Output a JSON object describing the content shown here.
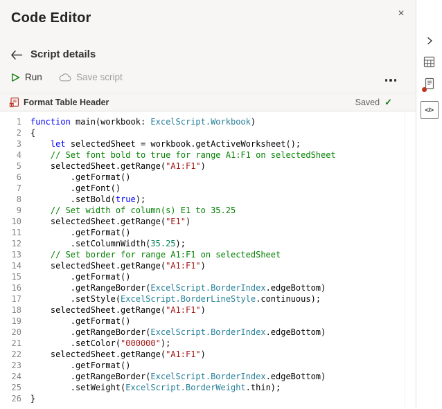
{
  "panel": {
    "title": "Code Editor"
  },
  "nav": {
    "back_label": "Script details"
  },
  "toolbar": {
    "run": "Run",
    "save": "Save script"
  },
  "script_header": {
    "name": "Format Table Header",
    "status": "Saved"
  },
  "rail": {
    "code_glyph": "</>"
  },
  "icons": {
    "close": "✕",
    "saved_check": "✓",
    "back_arrow": "left-arrow",
    "run_play": "play-triangle-outline",
    "save_cloud": "cloud",
    "more_ellipsis": "three-dots",
    "collapse_chevron": "chevron-right",
    "rail_table": "table-grid",
    "rail_scripts": "document-with-red-badge",
    "rail_code": "code-brackets"
  },
  "colors": {
    "run_green": "#107C10",
    "saved_check_green": "#107C10",
    "script_icon_red": "#B83426",
    "badge_red": "#C03522",
    "header_bg": "#f7f6f5"
  },
  "code": {
    "token_colors": {
      "kw": "#0000FF",
      "ty": "#267F99",
      "str": "#A31515",
      "com": "#008000",
      "num": "#098658",
      "pl": "#000000"
    },
    "lines": [
      [
        [
          "function",
          "kw"
        ],
        [
          " main(workbook: ",
          "pl"
        ],
        [
          "ExcelScript.Workbook",
          "ty"
        ],
        [
          ")",
          "pl"
        ]
      ],
      [
        [
          "{",
          "pl"
        ]
      ],
      [
        [
          "    ",
          "pl"
        ],
        [
          "let",
          "kw"
        ],
        [
          " selectedSheet = workbook.getActiveWorksheet();",
          "pl"
        ]
      ],
      [
        [
          "    // Set font bold to true for range A1:F1 on selectedSheet",
          "com"
        ]
      ],
      [
        [
          "    selectedSheet.getRange(",
          "pl"
        ],
        [
          "\"A1:F1\"",
          "str"
        ],
        [
          ")",
          "pl"
        ]
      ],
      [
        [
          "        .getFormat()",
          "pl"
        ]
      ],
      [
        [
          "        .getFont()",
          "pl"
        ]
      ],
      [
        [
          "        .setBold(",
          "pl"
        ],
        [
          "true",
          "kw"
        ],
        [
          ");",
          "pl"
        ]
      ],
      [
        [
          "    // Set width of column(s) E1 to 35.25",
          "com"
        ]
      ],
      [
        [
          "    selectedSheet.getRange(",
          "pl"
        ],
        [
          "\"E1\"",
          "str"
        ],
        [
          ")",
          "pl"
        ]
      ],
      [
        [
          "        .getFormat()",
          "pl"
        ]
      ],
      [
        [
          "        .setColumnWidth(",
          "pl"
        ],
        [
          "35.25",
          "num"
        ],
        [
          ");",
          "pl"
        ]
      ],
      [
        [
          "    // Set border for range A1:F1 on selectedSheet",
          "com"
        ]
      ],
      [
        [
          "    selectedSheet.getRange(",
          "pl"
        ],
        [
          "\"A1:F1\"",
          "str"
        ],
        [
          ")",
          "pl"
        ]
      ],
      [
        [
          "        .getFormat()",
          "pl"
        ]
      ],
      [
        [
          "        .getRangeBorder(",
          "pl"
        ],
        [
          "ExcelScript.BorderIndex",
          "ty"
        ],
        [
          ".edgeBottom)",
          "pl"
        ]
      ],
      [
        [
          "        .setStyle(",
          "pl"
        ],
        [
          "ExcelScript.BorderLineStyle",
          "ty"
        ],
        [
          ".continuous);",
          "pl"
        ]
      ],
      [
        [
          "    selectedSheet.getRange(",
          "pl"
        ],
        [
          "\"A1:F1\"",
          "str"
        ],
        [
          ")",
          "pl"
        ]
      ],
      [
        [
          "        .getFormat()",
          "pl"
        ]
      ],
      [
        [
          "        .getRangeBorder(",
          "pl"
        ],
        [
          "ExcelScript.BorderIndex",
          "ty"
        ],
        [
          ".edgeBottom)",
          "pl"
        ]
      ],
      [
        [
          "        .setColor(",
          "pl"
        ],
        [
          "\"000000\"",
          "str"
        ],
        [
          ");",
          "pl"
        ]
      ],
      [
        [
          "    selectedSheet.getRange(",
          "pl"
        ],
        [
          "\"A1:F1\"",
          "str"
        ],
        [
          ")",
          "pl"
        ]
      ],
      [
        [
          "        .getFormat()",
          "pl"
        ]
      ],
      [
        [
          "        .getRangeBorder(",
          "pl"
        ],
        [
          "ExcelScript.BorderIndex",
          "ty"
        ],
        [
          ".edgeBottom)",
          "pl"
        ]
      ],
      [
        [
          "        .setWeight(",
          "pl"
        ],
        [
          "ExcelScript.BorderWeight",
          "ty"
        ],
        [
          ".thin);",
          "pl"
        ]
      ],
      [
        [
          "}",
          "pl"
        ]
      ]
    ]
  }
}
